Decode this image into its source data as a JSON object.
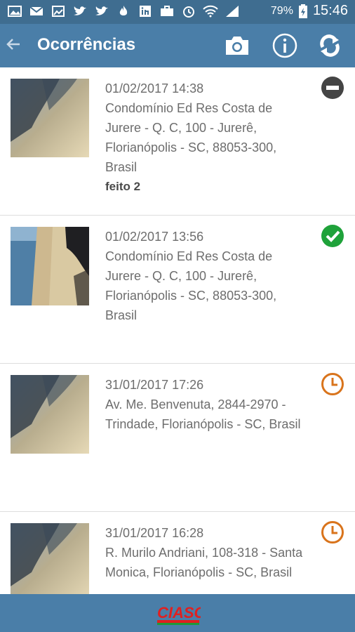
{
  "status_bar": {
    "battery": "79%",
    "time": "15:46"
  },
  "app_bar": {
    "title": "Ocorrências"
  },
  "items": [
    {
      "date": "01/02/2017 14:38",
      "address": "Condomínio Ed Res Costa de Jurere - Q. C, 100 - Jurerê, Florianópolis - SC, 88053-300, Brasil",
      "note": "feito 2",
      "status": "minus-circle-icon",
      "status_color": "#444444"
    },
    {
      "date": "01/02/2017 13:56",
      "address": "Condomínio Ed Res Costa de Jurere - Q. C, 100 - Jurerê, Florianópolis - SC, 88053-300, Brasil",
      "note": "",
      "status": "check-circle-icon",
      "status_color": "#1fa23a"
    },
    {
      "date": "31/01/2017 17:26",
      "address": "Av. Me. Benvenuta, 2844-2970 - Trindade, Florianópolis - SC, Brasil",
      "note": "",
      "status": "clock-icon",
      "status_color": "#d9741c"
    },
    {
      "date": "31/01/2017 16:28",
      "address": "R. Murilo Andriani, 108-318 - Santa Monica, Florianópolis - SC, Brasil",
      "note": "",
      "status": "clock-icon",
      "status_color": "#d9741c"
    }
  ],
  "footer": {
    "logo_text": "CIASC"
  },
  "colors": {
    "appbar": "#4a7ea8",
    "statusbar": "#3f6d90"
  }
}
